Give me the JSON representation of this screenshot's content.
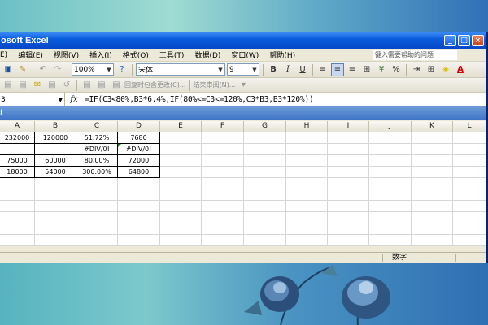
{
  "window": {
    "title": "osoft Excel",
    "minimize": "_",
    "maximize": "□",
    "close": "×"
  },
  "menu": [
    "编辑(E)",
    "视图(V)",
    "插入(I)",
    "格式(O)",
    "工具(T)",
    "数据(D)",
    "窗口(W)",
    "帮助(H)"
  ],
  "menu_file_fragment": "E)",
  "help_placeholder": "键入需要帮助的问题",
  "toolbar": {
    "zoom": "100%",
    "font_name": "宋体",
    "font_size": "9",
    "bold": "B",
    "italic": "I",
    "underline": "U",
    "percent": "%",
    "font_color": "A"
  },
  "toolbar2": {
    "reply_changes": "回复时包含更改(C)...",
    "end_review": "结束审阅(N)..."
  },
  "formula_bar": {
    "name_box": "3",
    "fx": "fx",
    "formula": "=IF(C3<80%,B3*6.4%,IF(80%<=C3<=120%,C3*B3,B3*120%))"
  },
  "sheet_band_text": "t",
  "columns": [
    "A",
    "B",
    "C",
    "D",
    "E",
    "F",
    "G",
    "H",
    "I",
    "J",
    "K",
    "L"
  ],
  "rows": [
    [
      "232000",
      "120000",
      "51.72%",
      "7680"
    ],
    [
      "",
      "",
      "#DIV/0!",
      "#DIV/0!"
    ],
    [
      "75000",
      "60000",
      "80.00%",
      "72000"
    ],
    [
      "18000",
      "54000",
      "300.00%",
      "64800"
    ]
  ],
  "status": {
    "mode": "数字"
  }
}
